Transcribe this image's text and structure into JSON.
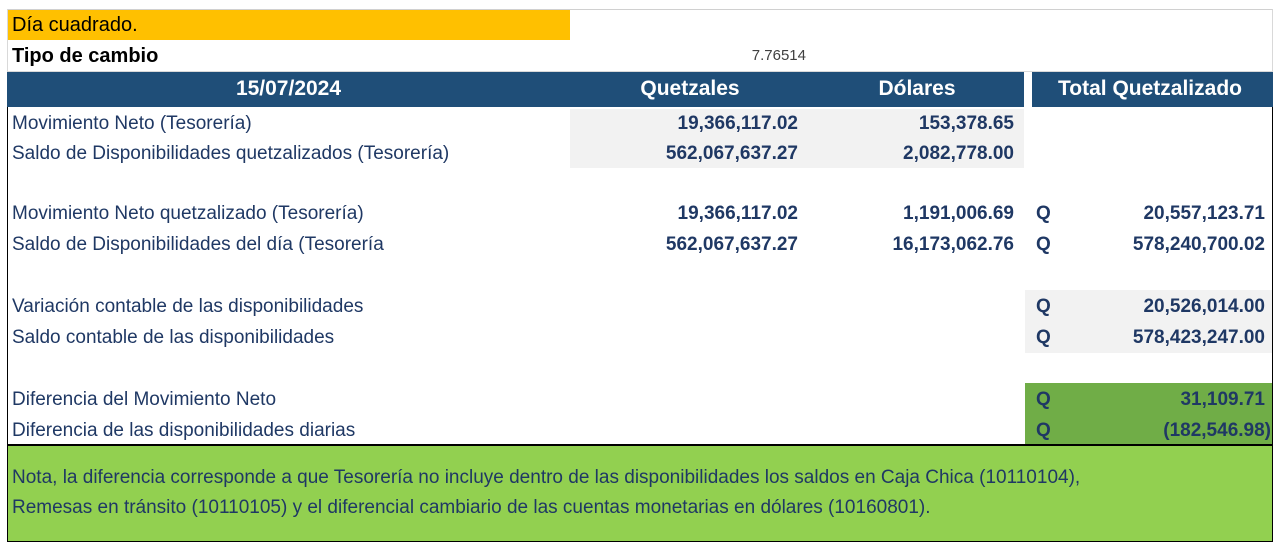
{
  "status": {
    "label": "Día cuadrado.",
    "color": "#ffc000"
  },
  "exchange": {
    "label": "Tipo de cambio",
    "value": "7.76514"
  },
  "header": {
    "date": "15/07/2024",
    "col_gtq": "Quetzales",
    "col_usd": "Dólares",
    "col_total": "Total Quetzalizado",
    "color": "#1f4e78"
  },
  "rows": [
    {
      "label": "Movimiento Neto (Tesorería)",
      "gtq": "19,366,117.02",
      "usd": "153,378.65",
      "cur": "",
      "total": ""
    },
    {
      "label": "Saldo de Disponibilidades quetzalizados (Tesorería)",
      "gtq": "562,067,637.27",
      "usd": "2,082,778.00",
      "cur": "",
      "total": ""
    },
    {
      "label": "Movimiento Neto quetzalizado (Tesorería)",
      "gtq": "19,366,117.02",
      "usd": "1,191,006.69",
      "cur": "Q",
      "total": "20,557,123.71"
    },
    {
      "label": "Saldo de Disponibilidades del día (Tesorería",
      "gtq": "562,067,637.27",
      "usd": "16,173,062.76",
      "cur": "Q",
      "total": "578,240,700.02"
    },
    {
      "label": "Variación contable de las disponibilidades",
      "gtq": "",
      "usd": "",
      "cur": "Q",
      "total": "20,526,014.00"
    },
    {
      "label": "Saldo contable de las disponibilidades",
      "gtq": "",
      "usd": "",
      "cur": "Q",
      "total": "578,423,247.00"
    },
    {
      "label": "Diferencia del Movimiento Neto",
      "gtq": "",
      "usd": "",
      "cur": "Q",
      "total": "31,109.71"
    },
    {
      "label": "Diferencia de las disponibilidades diarias",
      "gtq": "",
      "usd": "",
      "cur": "Q",
      "total": "(182,546.98)"
    }
  ],
  "note": {
    "line1": "Nota, la diferencia corresponde a que Tesorería no incluye dentro de las disponibilidades los saldos en Caja Chica (10110104),",
    "line2": "Remesas en tránsito (10110105) y el diferencial cambiario de las cuentas monetarias en dólares (10160801).",
    "color": "#92d050"
  }
}
